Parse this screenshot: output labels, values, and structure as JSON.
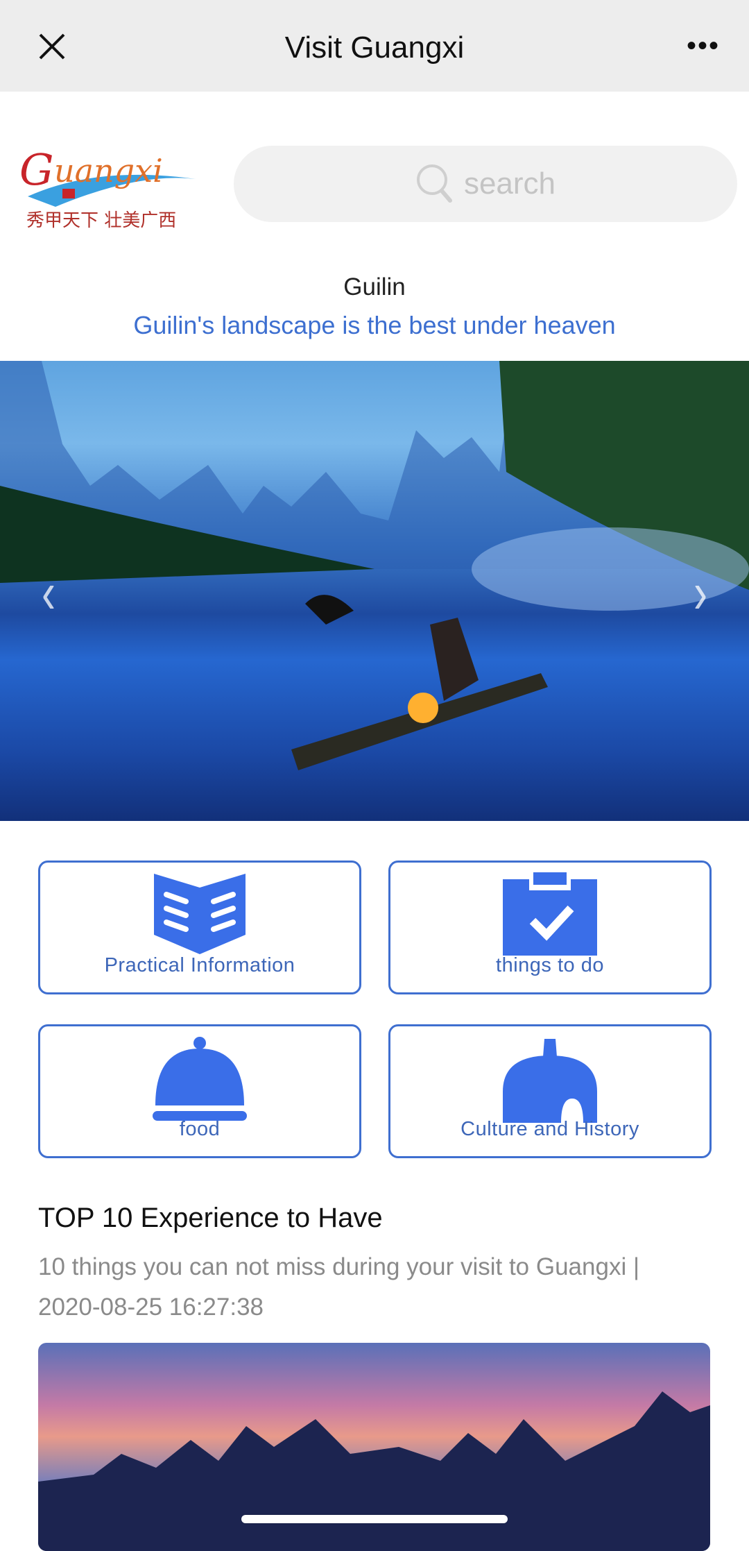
{
  "header": {
    "title": "Visit Guangxi",
    "close_icon": "close-icon",
    "more_icon": "more-icon",
    "more_label": "•••"
  },
  "logo": {
    "text": "Guangxi",
    "tagline": "秀甲天下 壮美广西"
  },
  "search": {
    "placeholder": "search",
    "icon": "search-icon"
  },
  "banner": {
    "title": "Guilin",
    "subtitle": "Guilin's landscape is the best under heaven",
    "prev": "‹",
    "next": "›"
  },
  "categories": [
    {
      "label": "Practical Information",
      "icon": "book-icon"
    },
    {
      "label": "things to do",
      "icon": "clipboard-check-icon"
    },
    {
      "label": "food",
      "icon": "cloche-icon"
    },
    {
      "label": "Culture and History",
      "icon": "dome-icon"
    }
  ],
  "article": {
    "title": "TOP 10 Experience to Have",
    "summary": "10 things you can not miss during your visit to Guangxi |",
    "date": "2020-08-25 16:27:38"
  },
  "colors": {
    "accent": "#3a6ee8",
    "header_bg": "#ededed",
    "link": "#3d6fd0"
  }
}
